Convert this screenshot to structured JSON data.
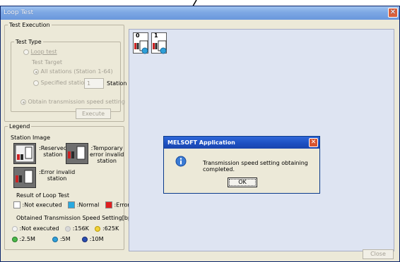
{
  "window": {
    "title": "Loop Test",
    "close_glyph": "✕"
  },
  "test_execution": {
    "legend": "Test Execution",
    "test_type_legend": "Test Type",
    "loop_test_label": "Loop test",
    "test_target_label": "Test Target",
    "all_stations_label": "All stations (Station 1-64)",
    "specified_station_label": "Specified station",
    "specified_station_value": "1",
    "station_suffix": "Station",
    "obtain_speed_label": "Obtain transmission speed setting",
    "execute_label": "Execute"
  },
  "legend_panel": {
    "legend": "Legend",
    "station_image_label": "Station Image",
    "reserved_label": ":Reserved\nstation",
    "temp_error_label": ":Temporary\nerror invalid\nstation",
    "error_invalid_label": ":Error invalid\nstation",
    "result_label": "Result of Loop Test",
    "not_executed_label": ":Not executed",
    "normal_label": ":Normal",
    "error_label": ":Error",
    "speed_heading": "Obtained Transmission Speed Setting[bps]",
    "speed_not_executed": ":Not executed",
    "speed_156k": ":156K",
    "speed_625k": ":625K",
    "speed_2_5m": ":2.5M",
    "speed_5m": ":5M",
    "speed_10m": ":10M",
    "colors": {
      "normal": "#29a9e0",
      "error": "#e02020",
      "not_executed": "#ffffff"
    }
  },
  "stations": [
    {
      "number": "0"
    },
    {
      "number": "1"
    }
  ],
  "dialog": {
    "title": "MELSOFT Application",
    "message": "Transmission speed setting obtaining completed.",
    "ok_label": "OK",
    "icon": "info-icon"
  },
  "close_label": "Close"
}
